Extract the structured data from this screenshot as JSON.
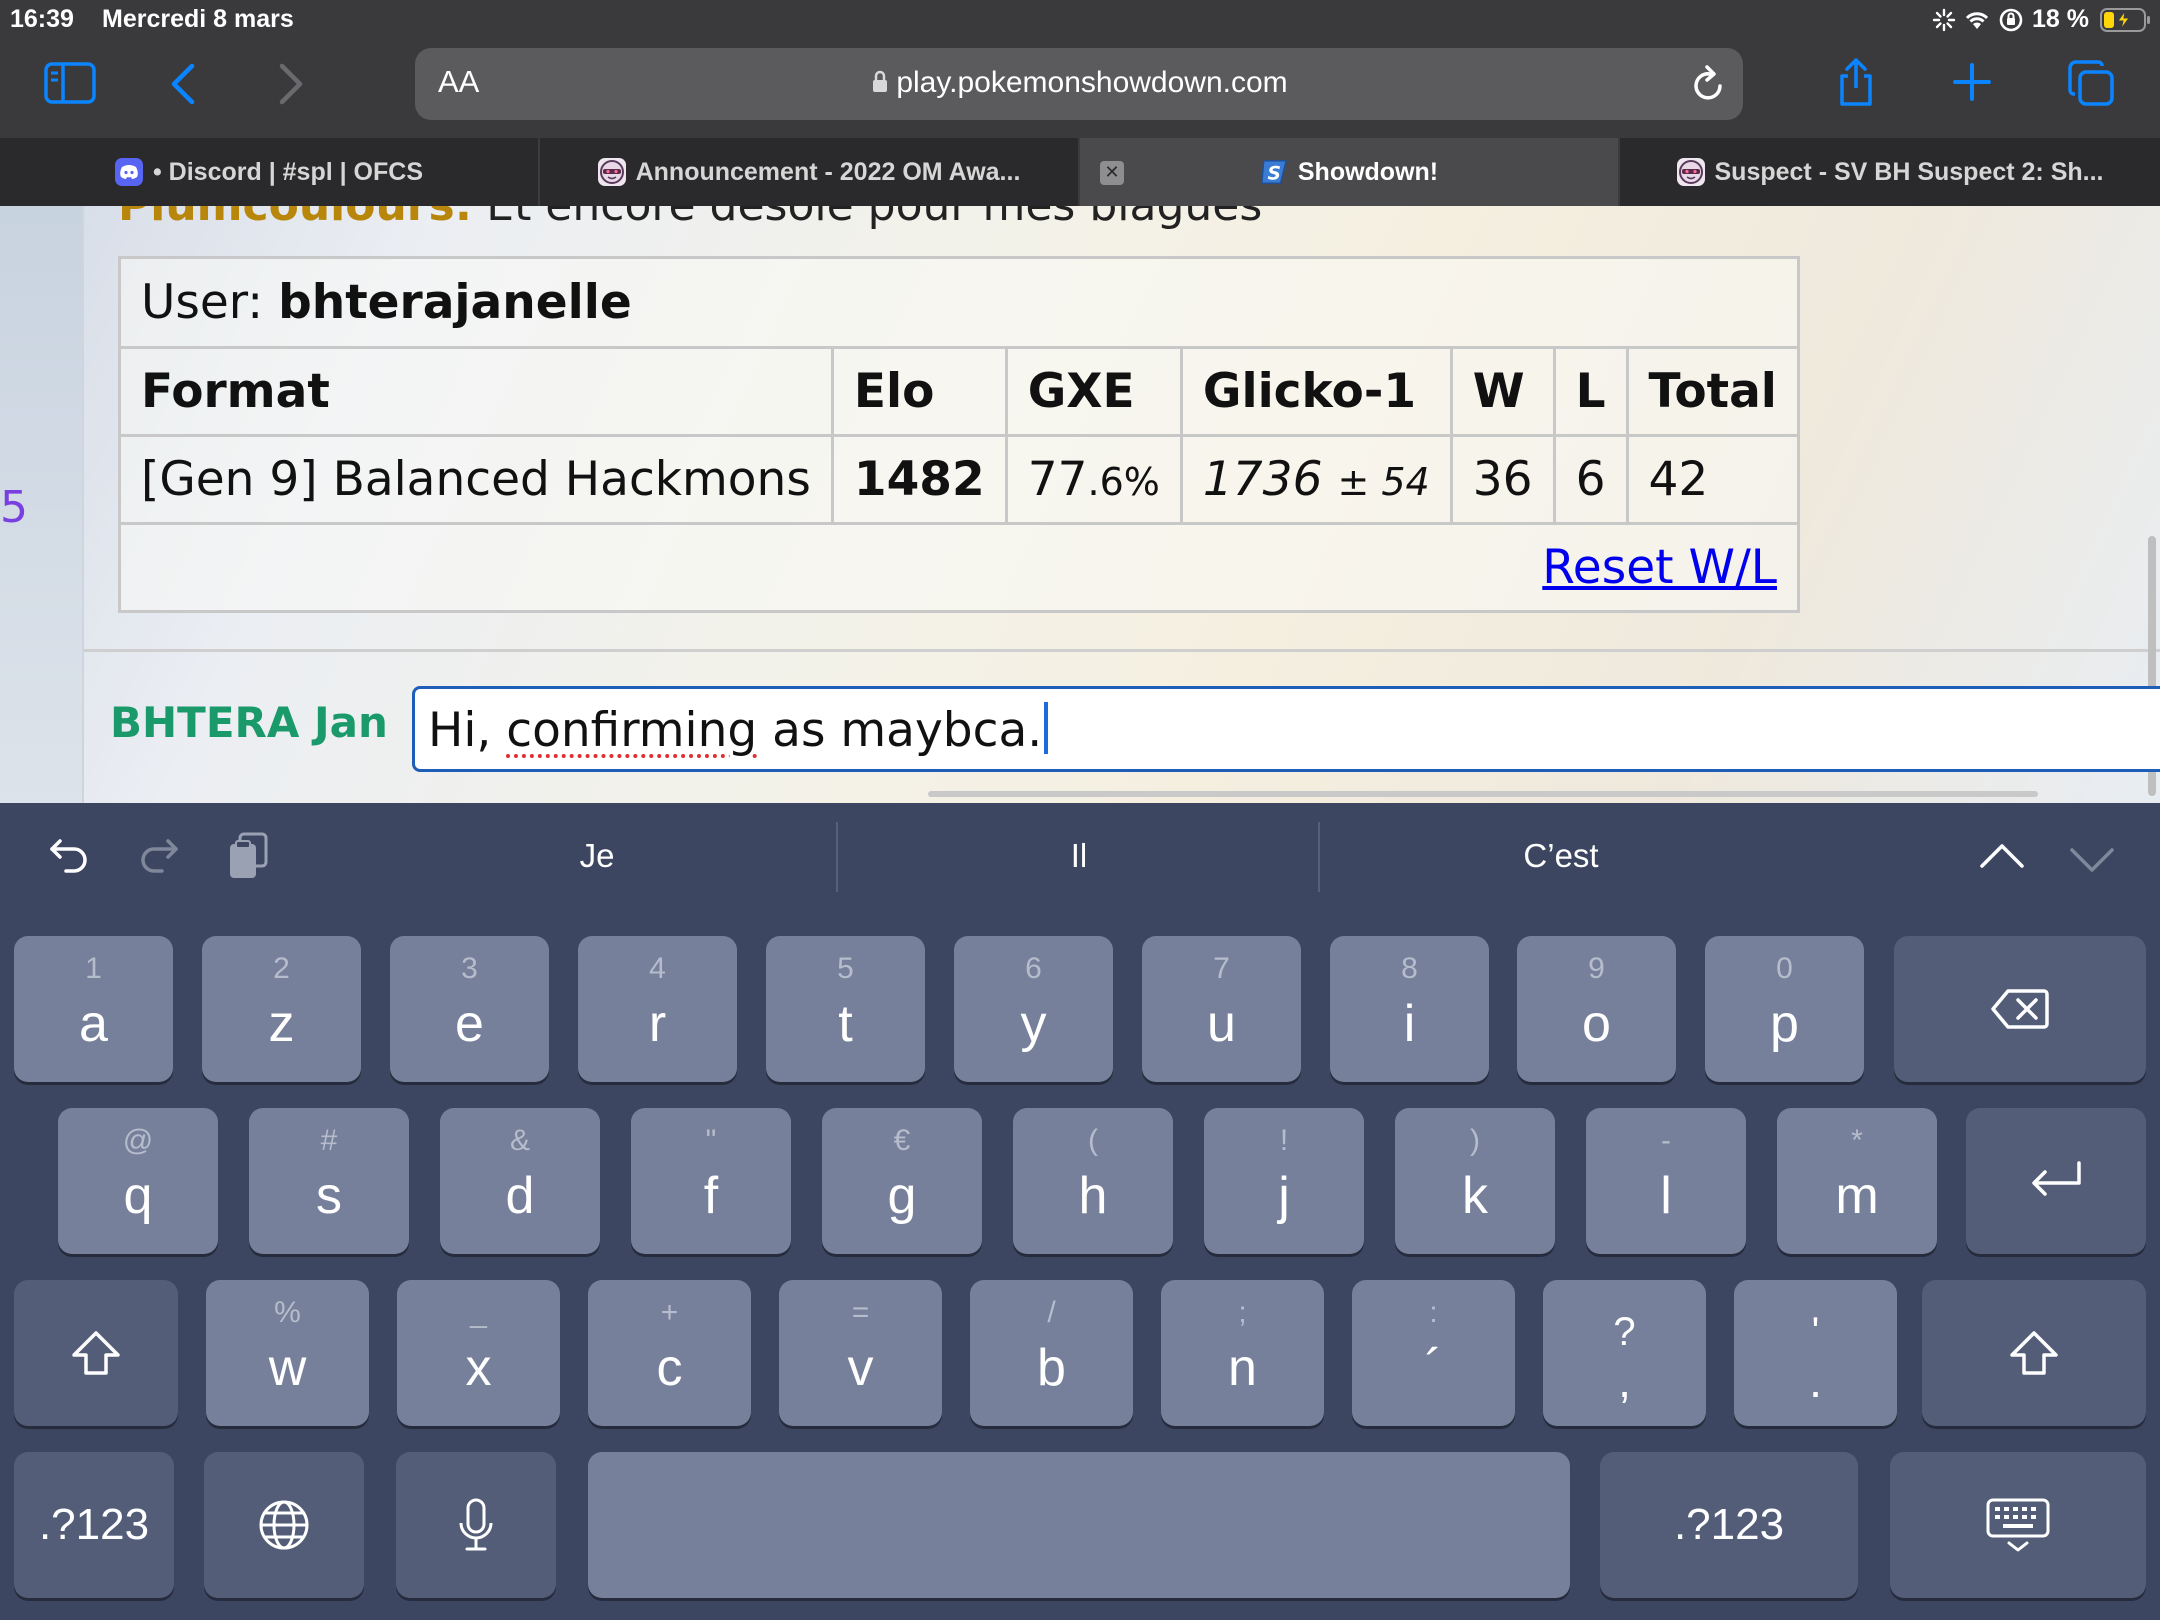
{
  "status_bar": {
    "time": "16:39",
    "date": "Mercredi 8 mars",
    "battery": "18 %",
    "icons": [
      "loading-spinner-icon",
      "wifi-icon",
      "orientation-lock-icon",
      "battery-charging-icon"
    ]
  },
  "browser": {
    "aa_label": "AA",
    "url": "play.pokemonshowdown.com",
    "toolbar_icons": [
      "sidebar-icon",
      "back-icon",
      "forward-icon",
      "reload-icon",
      "share-icon",
      "new-tab-icon",
      "tabs-overview-icon"
    ],
    "tabs": [
      {
        "label": "• Discord | #spl | OFCS",
        "favicon": "discord-icon",
        "active": false
      },
      {
        "label": "Announcement - 2022 OM Awa...",
        "favicon": "smogon-icon",
        "active": false
      },
      {
        "label": "Showdown!",
        "favicon": "showdown-icon",
        "active": true
      },
      {
        "label": "Suspect - SV BH Suspect 2: Sh...",
        "favicon": "smogon-icon",
        "active": false
      }
    ]
  },
  "chat": {
    "partial_line": {
      "name": "Plumcoulours:",
      "message": "Et encore désolé pour mes blagues"
    },
    "left_number": "5",
    "rank_table": {
      "user_label": "User:",
      "username": "bhterajanelle",
      "headers": [
        "Format",
        "Elo",
        "GXE",
        "Glicko-1",
        "W",
        "L",
        "Total"
      ],
      "row": {
        "format": "[Gen 9] Balanced Hackmons",
        "elo": "1482",
        "gxe_main": "77",
        "gxe_small": ".6%",
        "glicko_rating": "1736",
        "glicko_dev": "± 54",
        "w": "36",
        "l": "6",
        "total": "42"
      },
      "reset_link": "Reset W/L"
    },
    "input": {
      "username": "BHTERA Jan",
      "text_before": "Hi, ",
      "text_misspelled": "confirming",
      "text_after": " as maybca."
    }
  },
  "keyboard": {
    "tools": [
      "undo-icon",
      "redo-icon",
      "clipboard-icon"
    ],
    "suggestions": [
      "Je",
      "Il",
      "C’est"
    ],
    "row1": [
      {
        "hint": "1",
        "key": "a"
      },
      {
        "hint": "2",
        "key": "z"
      },
      {
        "hint": "3",
        "key": "e"
      },
      {
        "hint": "4",
        "key": "r"
      },
      {
        "hint": "5",
        "key": "t"
      },
      {
        "hint": "6",
        "key": "y"
      },
      {
        "hint": "7",
        "key": "u"
      },
      {
        "hint": "8",
        "key": "i"
      },
      {
        "hint": "9",
        "key": "o"
      },
      {
        "hint": "0",
        "key": "p"
      }
    ],
    "row2": [
      {
        "hint": "@",
        "key": "q"
      },
      {
        "hint": "#",
        "key": "s"
      },
      {
        "hint": "&",
        "key": "d"
      },
      {
        "hint": "\"",
        "key": "f"
      },
      {
        "hint": "€",
        "key": "g"
      },
      {
        "hint": "(",
        "key": "h"
      },
      {
        "hint": "!",
        "key": "j"
      },
      {
        "hint": ")",
        "key": "k"
      },
      {
        "hint": "-",
        "key": "l"
      },
      {
        "hint": "*",
        "key": "m"
      }
    ],
    "row3": [
      {
        "hint": "%",
        "key": "w"
      },
      {
        "hint": "_",
        "key": "x"
      },
      {
        "hint": "+",
        "key": "c"
      },
      {
        "hint": "=",
        "key": "v"
      },
      {
        "hint": "/",
        "key": "b"
      },
      {
        "hint": ";",
        "key": "n"
      },
      {
        "hint": ":",
        "key": "´"
      },
      {
        "hint": "?",
        "key": ","
      },
      {
        "hint": "'",
        "key": "."
      }
    ],
    "numbers_label": ".?123",
    "numbers_label_right": ".?123"
  }
}
